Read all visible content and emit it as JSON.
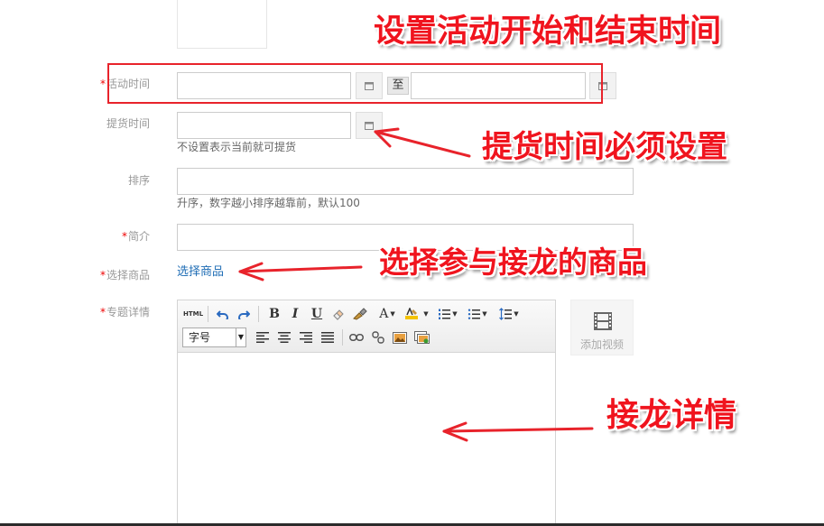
{
  "form": {
    "activity_time": {
      "required": "*",
      "label": "活动时间",
      "to_label": "至"
    },
    "pickup_time": {
      "label": "提货时间",
      "help": "不设置表示当前就可提货"
    },
    "sort": {
      "label": "排序",
      "help": "升序，数字越小排序越靠前，默认100"
    },
    "intro": {
      "required": "*",
      "label": "简介"
    },
    "select_goods": {
      "required": "*",
      "label": "选择商品",
      "link": "选择商品"
    },
    "detail": {
      "required": "*",
      "label": "专题详情"
    }
  },
  "editor": {
    "toolbar": {
      "html": "HTML",
      "bold": "B",
      "italic": "I",
      "underline": "U",
      "font_color": "A",
      "font_size_select": "字号"
    },
    "add_video_label": "添加视频"
  },
  "annotations": {
    "set_time": "设置活动开始和结束时间",
    "pickup_required": "提货时间必须设置",
    "select_goods": "选择参与接龙的商品",
    "detail": "接龙详情"
  },
  "colors": {
    "annotation": "#f0141e",
    "link": "#1f6db5",
    "required": "#e00000"
  }
}
